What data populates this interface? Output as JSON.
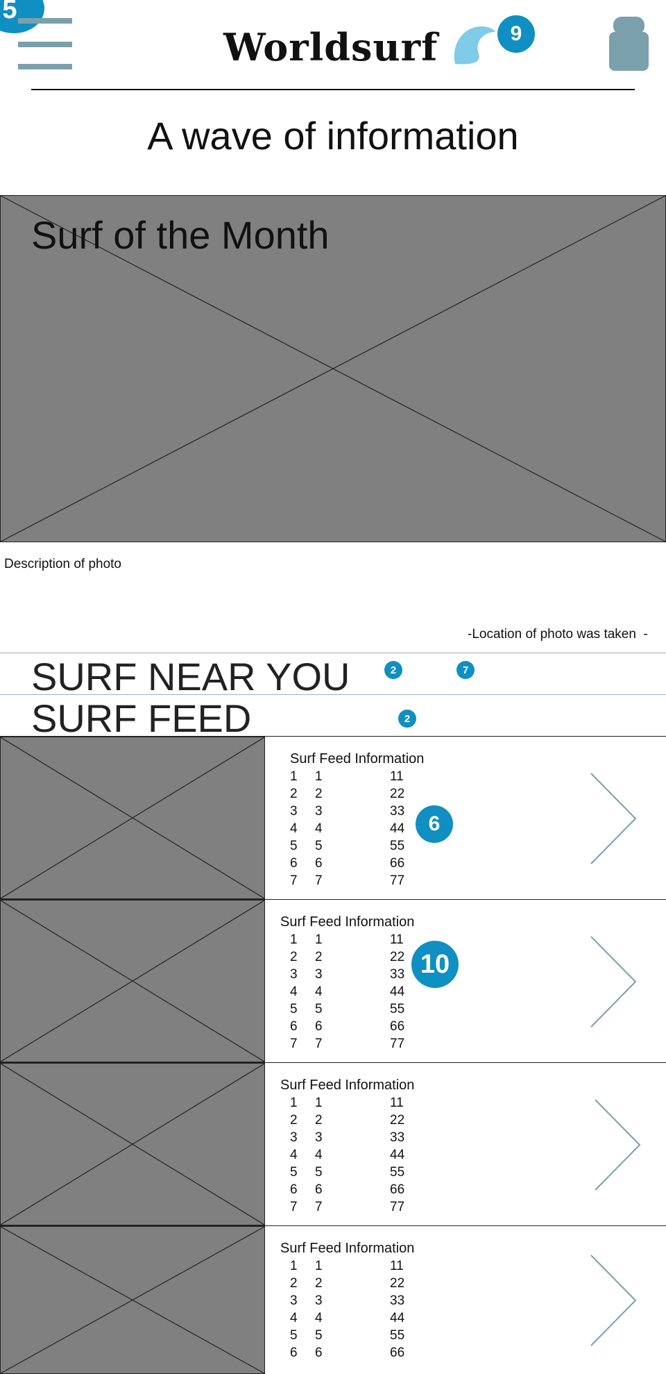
{
  "header": {
    "logo": "Worldsurf",
    "badge_menu": "5",
    "badge_logo": "9"
  },
  "tagline": "A wave of information",
  "hero": {
    "title": "Surf of the Month",
    "description": "Description of photo",
    "location": "-Location of photo was taken  -"
  },
  "sections": {
    "near_you": "SURF NEAR YOU",
    "near_you_badge_a": "2",
    "near_you_badge_b": "7",
    "feed": "SURF FEED",
    "feed_badge": "2"
  },
  "feed": [
    {
      "title": "Surf Feed Information",
      "badge": "6",
      "rows": [
        [
          "1",
          "1",
          "11"
        ],
        [
          "2",
          "2",
          "22"
        ],
        [
          "3",
          "3",
          "33"
        ],
        [
          "4",
          "4",
          "44"
        ],
        [
          "5",
          "5",
          "55"
        ],
        [
          "6",
          "6",
          "66"
        ],
        [
          "7",
          "7",
          "77"
        ]
      ]
    },
    {
      "title": "Surf Feed Information",
      "badge": "10",
      "rows": [
        [
          "1",
          "1",
          "11"
        ],
        [
          "2",
          "2",
          "22"
        ],
        [
          "3",
          "3",
          "33"
        ],
        [
          "4",
          "4",
          "44"
        ],
        [
          "5",
          "5",
          "55"
        ],
        [
          "6",
          "6",
          "66"
        ],
        [
          "7",
          "7",
          "77"
        ]
      ]
    },
    {
      "title": "Surf Feed Information",
      "badge": "",
      "rows": [
        [
          "1",
          "1",
          "11"
        ],
        [
          "2",
          "2",
          "22"
        ],
        [
          "3",
          "3",
          "33"
        ],
        [
          "4",
          "4",
          "44"
        ],
        [
          "5",
          "5",
          "55"
        ],
        [
          "6",
          "6",
          "66"
        ],
        [
          "7",
          "7",
          "77"
        ]
      ]
    },
    {
      "title": "Surf Feed Information",
      "badge": "",
      "rows": [
        [
          "1",
          "1",
          "11"
        ],
        [
          "2",
          "2",
          "22"
        ],
        [
          "3",
          "3",
          "33"
        ],
        [
          "4",
          "4",
          "44"
        ],
        [
          "5",
          "5",
          "55"
        ],
        [
          "6",
          "6",
          "66"
        ]
      ]
    }
  ],
  "colors": {
    "accent": "#0f8fc2",
    "menu_icon": "#7aa0ab",
    "logo_wave": "#7fcbe8",
    "placeholder": "#808080",
    "divider_blue": "#9cb4bc"
  },
  "icons": [
    "hamburger-menu-icon",
    "wave-logo-icon",
    "user-profile-icon",
    "chevron-right-icon"
  ]
}
